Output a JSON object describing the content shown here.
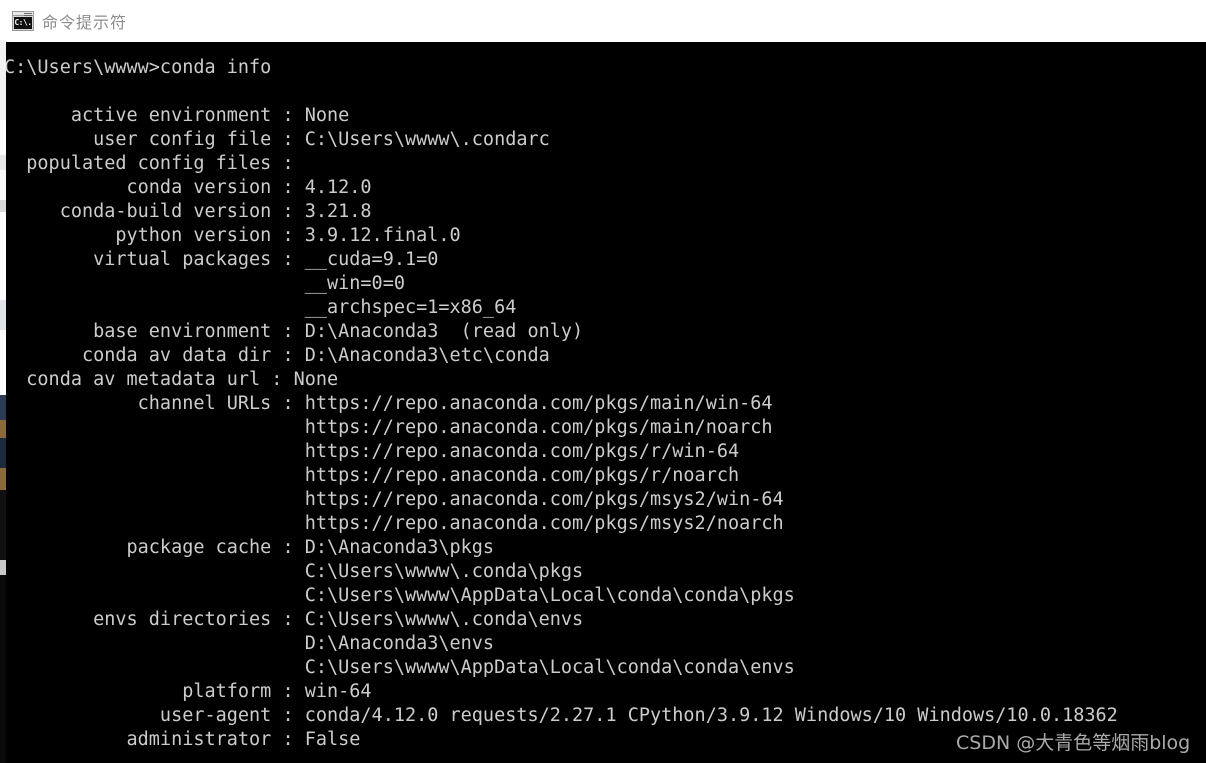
{
  "window": {
    "title": "命令提示符",
    "icon": "cmd-icon",
    "icon_glyph": "C:\\.",
    "title_color": "#8c8c8c",
    "titlebar_bg": "#ffffff",
    "console_bg": "#000000",
    "console_fg": "#cccccc"
  },
  "console": {
    "prompt_line": "C:\\Users\\wwww>conda info",
    "lines": [
      "C:\\Users\\wwww>conda info",
      "",
      "     active environment : None",
      "     user config file : C:\\Users\\wwww\\.condarc",
      "populated config files :",
      "          conda version : 4.12.0",
      "    conda-build version : 3.21.8",
      "         python version : 3.9.12.final.0",
      "       virtual packages : __cuda=9.1=0",
      "                          __win=0=0",
      "                          __archspec=1=x86_64",
      "       base environment : D:\\Anaconda3  (read only)",
      "      conda av data dir : D:\\Anaconda3\\etc\\conda",
      "   conda av metadata url : None",
      "           channel URLs : https://repo.anaconda.com/pkgs/main/win-64",
      "                          https://repo.anaconda.com/pkgs/main/noarch",
      "                          https://repo.anaconda.com/pkgs/r/win-64",
      "                          https://repo.anaconda.com/pkgs/r/noarch",
      "                          https://repo.anaconda.com/pkgs/msys2/win-64",
      "                          https://repo.anaconda.com/pkgs/msys2/noarch",
      "          package cache : D:\\Anaconda3\\pkgs",
      "                          C:\\Users\\wwww\\.conda\\pkgs",
      "                          C:\\Users\\wwww\\AppData\\Local\\conda\\conda\\pkgs",
      "       envs directories : C:\\Users\\wwww\\.conda\\envs",
      "                          D:\\Anaconda3\\envs",
      "                          C:\\Users\\wwww\\AppData\\Local\\conda\\conda\\envs",
      "               platform : win-64",
      "             user-agent : conda/4.12.0 requests/2.27.1 CPython/3.9.12 Windows/10 Windows/10.0.18362",
      "          administrator : False"
    ],
    "text": "C:\\Users\\wwww>conda info\n\n      active environment : None\n        user config file : C:\\Users\\wwww\\.condarc\n  populated config files :\n           conda version : 4.12.0\n     conda-build version : 3.21.8\n          python version : 3.9.12.final.0\n        virtual packages : __cuda=9.1=0\n                           __win=0=0\n                           __archspec=1=x86_64\n        base environment : D:\\Anaconda3  (read only)\n       conda av data dir : D:\\Anaconda3\\etc\\conda\n  conda av metadata url : None\n            channel URLs : https://repo.anaconda.com/pkgs/main/win-64\n                           https://repo.anaconda.com/pkgs/main/noarch\n                           https://repo.anaconda.com/pkgs/r/win-64\n                           https://repo.anaconda.com/pkgs/r/noarch\n                           https://repo.anaconda.com/pkgs/msys2/win-64\n                           https://repo.anaconda.com/pkgs/msys2/noarch\n           package cache : D:\\Anaconda3\\pkgs\n                           C:\\Users\\wwww\\.conda\\pkgs\n                           C:\\Users\\wwww\\AppData\\Local\\conda\\conda\\pkgs\n        envs directories : C:\\Users\\wwww\\.conda\\envs\n                           D:\\Anaconda3\\envs\n                           C:\\Users\\wwww\\AppData\\Local\\conda\\conda\\envs\n                platform : win-64\n              user-agent : conda/4.12.0 requests/2.27.1 CPython/3.9.12 Windows/10 Windows/10.0.18362\n           administrator : False",
    "fields": [
      {
        "label": "active environment",
        "value": "None"
      },
      {
        "label": "user config file",
        "value": "C:\\Users\\wwww\\.condarc"
      },
      {
        "label": "populated config files",
        "value": ""
      },
      {
        "label": "conda version",
        "value": "4.12.0"
      },
      {
        "label": "conda-build version",
        "value": "3.21.8"
      },
      {
        "label": "python version",
        "value": "3.9.12.final.0"
      },
      {
        "label": "virtual packages",
        "value": "__cuda=9.1=0"
      },
      {
        "label": "",
        "value": "__win=0=0"
      },
      {
        "label": "",
        "value": "__archspec=1=x86_64"
      },
      {
        "label": "base environment",
        "value": "D:\\Anaconda3  (read only)"
      },
      {
        "label": "conda av data dir",
        "value": "D:\\Anaconda3\\etc\\conda"
      },
      {
        "label": "conda av metadata url",
        "value": "None"
      },
      {
        "label": "channel URLs",
        "value": "https://repo.anaconda.com/pkgs/main/win-64"
      },
      {
        "label": "",
        "value": "https://repo.anaconda.com/pkgs/main/noarch"
      },
      {
        "label": "",
        "value": "https://repo.anaconda.com/pkgs/r/win-64"
      },
      {
        "label": "",
        "value": "https://repo.anaconda.com/pkgs/r/noarch"
      },
      {
        "label": "",
        "value": "https://repo.anaconda.com/pkgs/msys2/win-64"
      },
      {
        "label": "",
        "value": "https://repo.anaconda.com/pkgs/msys2/noarch"
      },
      {
        "label": "package cache",
        "value": "D:\\Anaconda3\\pkgs"
      },
      {
        "label": "",
        "value": "C:\\Users\\wwww\\.conda\\pkgs"
      },
      {
        "label": "",
        "value": "C:\\Users\\wwww\\AppData\\Local\\conda\\conda\\pkgs"
      },
      {
        "label": "envs directories",
        "value": "C:\\Users\\wwww\\.conda\\envs"
      },
      {
        "label": "",
        "value": "D:\\Anaconda3\\envs"
      },
      {
        "label": "",
        "value": "C:\\Users\\wwww\\AppData\\Local\\conda\\conda\\envs"
      },
      {
        "label": "platform",
        "value": "win-64"
      },
      {
        "label": "user-agent",
        "value": "conda/4.12.0 requests/2.27.1 CPython/3.9.12 Windows/10 Windows/10.0.18362"
      },
      {
        "label": "administrator",
        "value": "False"
      }
    ]
  },
  "watermark": {
    "text": "CSDN @大青色等烟雨blog",
    "color": "#b9b9b9"
  }
}
